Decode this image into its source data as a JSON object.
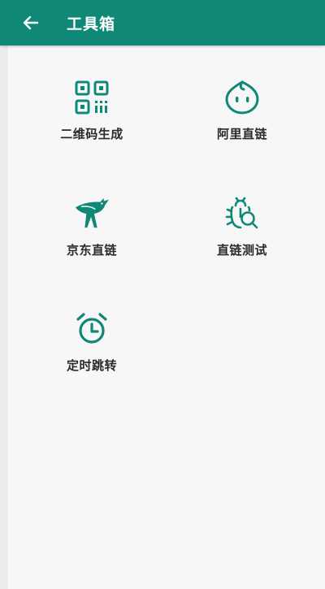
{
  "app_bar": {
    "title": "工具箱",
    "back_icon": "arrow-left-icon"
  },
  "tools": [
    {
      "label": "二维码生成",
      "icon": "qr-code-icon"
    },
    {
      "label": "阿里直链",
      "icon": "ali-drive-icon"
    },
    {
      "label": "京东直链",
      "icon": "jd-dog-icon"
    },
    {
      "label": "直链测试",
      "icon": "bug-search-icon"
    },
    {
      "label": "定时跳转",
      "icon": "alarm-clock-icon"
    }
  ],
  "colors": {
    "app_bar": "#0f8877",
    "icon": "#0f8877",
    "label": "#2a2a2a",
    "background": "#f7f7f7"
  }
}
